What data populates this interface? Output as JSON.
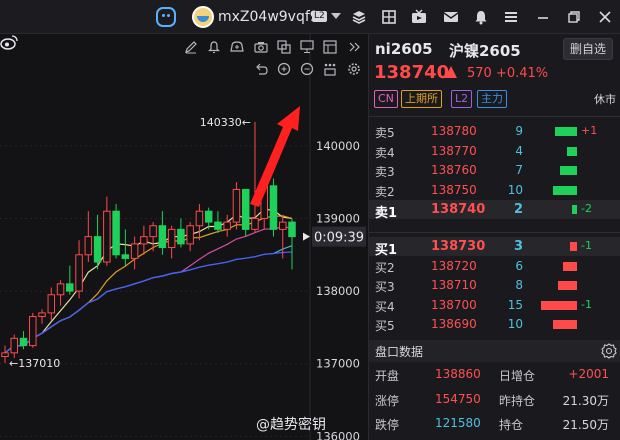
{
  "topbar": {
    "username": "mxZ04w9vqf9",
    "level_badge": "L2",
    "icons": [
      "app-logo-icon",
      "avatar",
      "chevron-down-icon",
      "layers-icon",
      "grid-icon",
      "video-icon",
      "mail-icon",
      "bell-icon",
      "menu-icon",
      "minimize-icon",
      "restore-icon",
      "close-icon"
    ]
  },
  "chart": {
    "toolbar_icons": [
      "edit-icon",
      "bell-icon",
      "bell-plus-icon",
      "camera-icon",
      "copy-icon",
      "monitor-icon",
      "layout-icon",
      "collapse-icon",
      "undo-icon",
      "zoom-in-icon",
      "zoom-out-icon",
      "tools-icon",
      "settings-icon"
    ],
    "high_label": "140330",
    "low_label": "137010",
    "countdown": "0:09:39",
    "colors": {
      "up": "#ff4a4a",
      "down": "#1fd15a",
      "ma5": "#e8e0a0",
      "ma10": "#d8a020",
      "ma20": "#d050a0",
      "ma40": "#30c0c0",
      "ma60": "#4a5aff",
      "arrow": "#ff2020"
    }
  },
  "chart_data": {
    "type": "candlestick",
    "y_ticks": [
      140000,
      139000,
      138000,
      137000,
      136000
    ],
    "ylim": [
      135950,
      141540
    ],
    "candles": [
      {
        "o": 137100,
        "h": 137250,
        "l": 137010,
        "c": 137150
      },
      {
        "o": 137150,
        "h": 137400,
        "l": 137080,
        "c": 137350
      },
      {
        "o": 137350,
        "h": 137450,
        "l": 137200,
        "c": 137250
      },
      {
        "o": 137250,
        "h": 137700,
        "l": 137220,
        "c": 137650
      },
      {
        "o": 137650,
        "h": 137750,
        "l": 137550,
        "c": 137700
      },
      {
        "o": 137700,
        "h": 138050,
        "l": 137600,
        "c": 137950
      },
      {
        "o": 137950,
        "h": 138150,
        "l": 137800,
        "c": 138100
      },
      {
        "o": 138100,
        "h": 138350,
        "l": 137950,
        "c": 138000
      },
      {
        "o": 138000,
        "h": 138700,
        "l": 137900,
        "c": 138500
      },
      {
        "o": 138500,
        "h": 139100,
        "l": 138400,
        "c": 138750
      },
      {
        "o": 138750,
        "h": 139050,
        "l": 138300,
        "c": 138400
      },
      {
        "o": 138400,
        "h": 139300,
        "l": 138350,
        "c": 139100
      },
      {
        "o": 139100,
        "h": 139200,
        "l": 138450,
        "c": 138500
      },
      {
        "o": 138500,
        "h": 138850,
        "l": 138350,
        "c": 138450
      },
      {
        "o": 138450,
        "h": 138750,
        "l": 138300,
        "c": 138650
      },
      {
        "o": 138650,
        "h": 138900,
        "l": 138500,
        "c": 138750
      },
      {
        "o": 138750,
        "h": 138950,
        "l": 138550,
        "c": 138900
      },
      {
        "o": 138900,
        "h": 139100,
        "l": 138500,
        "c": 138600
      },
      {
        "o": 138600,
        "h": 138900,
        "l": 138450,
        "c": 138850
      },
      {
        "o": 138850,
        "h": 139000,
        "l": 138600,
        "c": 138650
      },
      {
        "o": 138650,
        "h": 138950,
        "l": 138550,
        "c": 138900
      },
      {
        "o": 138900,
        "h": 139200,
        "l": 138700,
        "c": 139100
      },
      {
        "o": 139100,
        "h": 139150,
        "l": 138850,
        "c": 138950
      },
      {
        "o": 138950,
        "h": 139100,
        "l": 138800,
        "c": 138850
      },
      {
        "o": 138850,
        "h": 139050,
        "l": 138750,
        "c": 138950
      },
      {
        "o": 138950,
        "h": 139500,
        "l": 138850,
        "c": 139400
      },
      {
        "o": 139400,
        "h": 139350,
        "l": 138750,
        "c": 138850
      },
      {
        "o": 138850,
        "h": 140330,
        "l": 138800,
        "c": 139000
      },
      {
        "o": 139000,
        "h": 139650,
        "l": 138850,
        "c": 139450
      },
      {
        "o": 139450,
        "h": 139550,
        "l": 138750,
        "c": 138850
      },
      {
        "o": 138850,
        "h": 139050,
        "l": 138450,
        "c": 138950
      },
      {
        "o": 138950,
        "h": 139000,
        "l": 138300,
        "c": 138750
      }
    ]
  },
  "quote": {
    "code": "ni2605",
    "name": "沪镍2605",
    "delete_btn": "删自选",
    "last_price": "138740",
    "change": "570",
    "change_pct": "+0.41%",
    "tags": [
      {
        "label": "CN",
        "color": "#e060c0"
      },
      {
        "label": "上期所",
        "color": "#e0a020"
      },
      {
        "label": "L2",
        "color": "#a060e0"
      },
      {
        "label": "主力",
        "color": "#3a90e0"
      }
    ],
    "status": "休市",
    "asks": [
      {
        "label": "卖5",
        "price": "138780",
        "vol": "9",
        "vol_num": 9,
        "delta": "+1"
      },
      {
        "label": "卖4",
        "price": "138770",
        "vol": "4",
        "vol_num": 4,
        "delta": ""
      },
      {
        "label": "卖3",
        "price": "138760",
        "vol": "7",
        "vol_num": 7,
        "delta": ""
      },
      {
        "label": "卖2",
        "price": "138750",
        "vol": "10",
        "vol_num": 10,
        "delta": ""
      },
      {
        "label": "卖1",
        "price": "138740",
        "vol": "2",
        "vol_num": 2,
        "delta": "-2"
      }
    ],
    "bids": [
      {
        "label": "买1",
        "price": "138730",
        "vol": "3",
        "vol_num": 3,
        "delta": "-1"
      },
      {
        "label": "买2",
        "price": "138720",
        "vol": "6",
        "vol_num": 6,
        "delta": ""
      },
      {
        "label": "买3",
        "price": "138710",
        "vol": "8",
        "vol_num": 8,
        "delta": ""
      },
      {
        "label": "买4",
        "price": "138700",
        "vol": "15",
        "vol_num": 15,
        "delta": "-1"
      },
      {
        "label": "买5",
        "price": "138690",
        "vol": "10",
        "vol_num": 10,
        "delta": ""
      }
    ],
    "section_title": "盘口数据",
    "stats": [
      {
        "k1": "开盘",
        "v1": "138860",
        "k2": "日增仓",
        "v2": "+2001"
      },
      {
        "k1": "涨停",
        "v1": "154750",
        "k2": "昨持仓",
        "v2": "21.30万"
      },
      {
        "k1": "跌停",
        "v1": "121580",
        "k2": "持仓",
        "v2": "21.50万"
      }
    ]
  },
  "watermark": "@趋势密钥"
}
